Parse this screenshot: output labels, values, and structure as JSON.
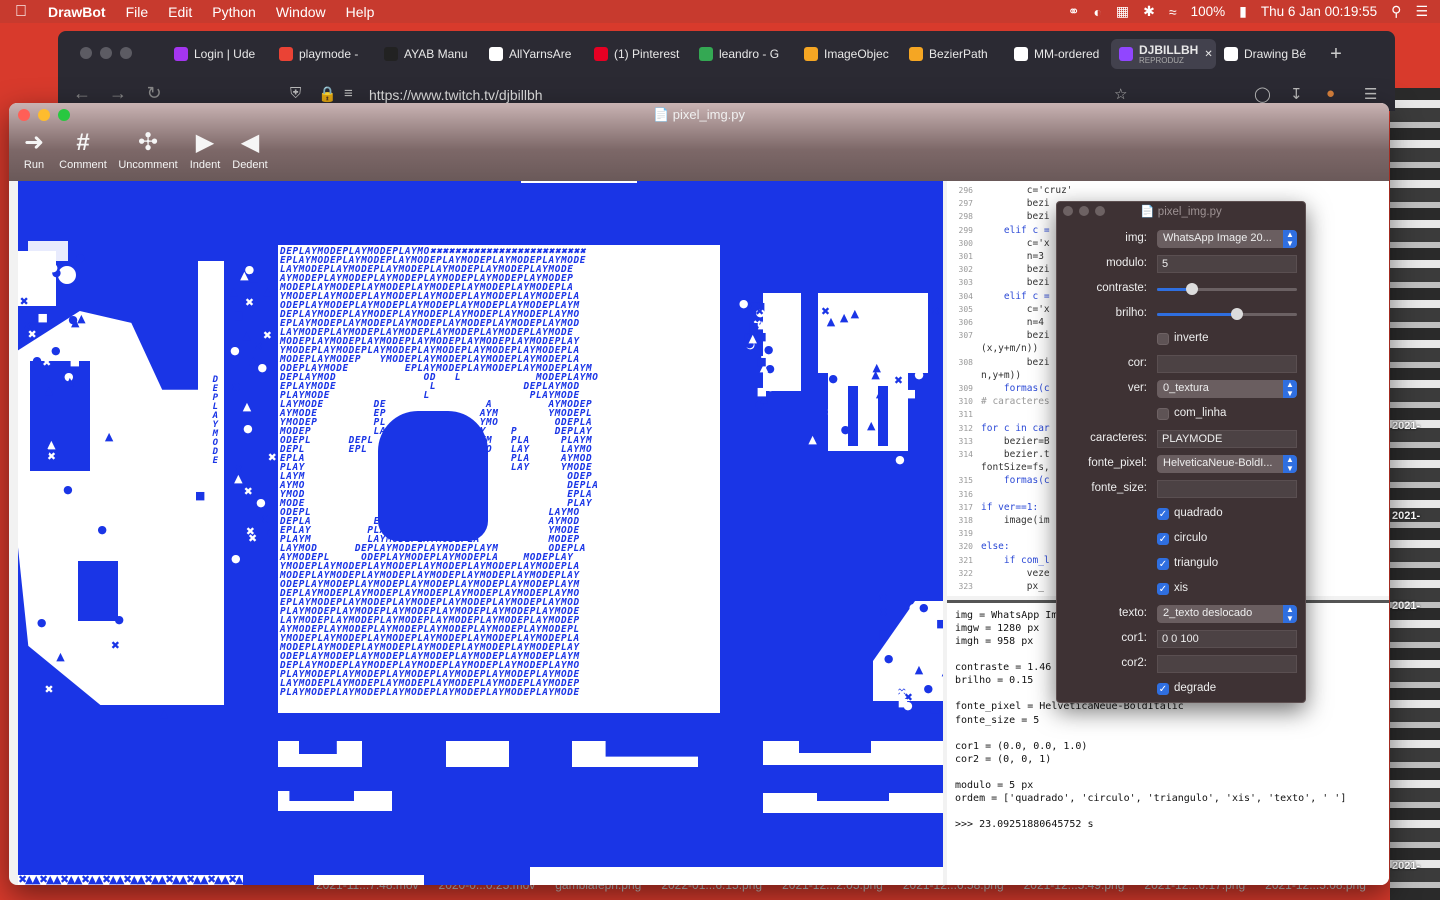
{
  "menubar": {
    "app": "DrawBot",
    "items": [
      "File",
      "Edit",
      "Python",
      "Window",
      "Help"
    ],
    "battery": "100%",
    "datetime": "Thu 6 Jan  00:19:55"
  },
  "browser": {
    "tabs": [
      {
        "label": "Login | Ude",
        "color": "#a435f0"
      },
      {
        "label": "playmode -",
        "color": "#ea4335"
      },
      {
        "label": "AYAB Manu",
        "color": "#222222"
      },
      {
        "label": "AllYarnsAre",
        "color": "#ffffff"
      },
      {
        "label": "(1) Pinterest",
        "color": "#e60023"
      },
      {
        "label": "leandro - G",
        "color": "#34a853"
      },
      {
        "label": "ImageObjec",
        "color": "#f5a623"
      },
      {
        "label": "BezierPath",
        "color": "#f5a623"
      },
      {
        "label": "MM-ordered",
        "color": "#ffffff"
      },
      {
        "label": "DJBILLBH",
        "sub": "REPRODUZ",
        "color": "#9146ff",
        "active": true
      },
      {
        "label": "Drawing Bé",
        "color": "#ffffff"
      }
    ],
    "url": "https://www.twitch.tv/djbillbh"
  },
  "drawbot": {
    "title": "pixel_img.py",
    "toolbar": [
      {
        "label": "Run",
        "icon": "run-icon"
      },
      {
        "label": "Comment",
        "icon": "comment-icon"
      },
      {
        "label": "Uncomment",
        "icon": "uncomment-icon"
      },
      {
        "label": "Indent",
        "icon": "indent-icon"
      },
      {
        "label": "Dedent",
        "icon": "dedent-icon"
      }
    ],
    "canvas": {
      "background": "#1a35e6",
      "text_rows": [
        "DEPLAYMODEPLAYMODEPLAYMO✖✖✖✖✖✖✖✖✖✖✖✖✖✖✖✖✖✖✖✖✖✖✖✖✖",
        "EPLAYMODEPLAYMODEPLAYMODEPLAYMODEPLAYMODEPLAYMODE",
        "LAYMODEPLAYMODEPLAYMODEPLAYMODEPLAYMODEPLAYMODE",
        "AYMODEPLAYMODEPLAYMODEPLAYMODEPLAYMODEPLAYMODEP",
        "MODEPLAYMODEPLAYMODEPLAYMODEPLAYMODEPLAYMODEPLA",
        "YMODEPLAYMODEPLAYMODEPLAYMODEPLAYMODEPLAYMODEPLA",
        "ODEPLAYMODEPLAYMODEPLAYMODEPLAYMODEPLAYMODEPLAYM",
        "DEPLAYMODEPLAYMODEPLAYMODEPLAYMODEPLAYMODEPLAYMO",
        "EPLAYMODEPLAYMODEPLAYMODEPLAYMODEPLAYMODEPLAYMOD",
        "LAYMODEPLAYMODEPLAYMODEPLAYMODEPLAYMODEPLAYMODE",
        "MODEPLAYMODEPLAYMODEPLAYMODEPLAYMODEPLAYMODEPLAY",
        "YMODEPLAYMODEPLAYMODEPLAYMODEPLAYMODEPLAYMODEPLA",
        "MODEPLAYMODEP   YMODEPLAYMODEPLAYMODEPLAYMODEPLA",
        "ODEPLAYMODE         EPLAYMODEPLAYMODEPLAYMODEPLAYM",
        "DEPLAYMOD              OD   L            MODEPLAYMO",
        "EPLAYMODE               L              DEPLAYMOD",
        "PLAYMODE               L                PLAYMODE",
        "LAYMODE        DE                A         AYMODEP",
        "AYMODE         EP               AYM        YMODEPL",
        "YMODEP         PL               YMO         ODEPLA",
        "MODEP          LA              AY    P      DEPLAY",
        "ODEPL      DEPL    MOD         AYM   PLA     PLAYM",
        "DEPL       EPL    ODE          YMO   LAY     LAYMO",
        "EPLA              MO                 PLA     AYMOD",
        "PLAY              OD                 LAY     YMODE",
        "LAYM                                          ODEP",
        "AYMO                                          DEPLA",
        "YMOD                  E                       EPLA",
        "MODE                EPLAYMOD                  PLAY",
        "ODEPL            EPLAYMODEPLAY             LAYMO",
        "DEPLA          EPLAYMODEPLAYMOD            AYMOD",
        "EPLAY         PLAYMODEPLAYMODEP            YMODE",
        "PLAYM         LAYMODEPLAYMODEPLA           MODEP",
        "LAYMOD      DEPLAYMODEPLAYMODEPLAYM        ODEPLA",
        "AYMODEPL     ODEPLAYMODEPLAYMODEPLA    MODEPLAY",
        "YMODEPLAYMODEPLAYMODEPLAYMODEPLAYMODEPLAYMODEPLA",
        "MODEPLAYMODEPLAYMODEPLAYMODEPLAYMODEPLAYMODEPLAY",
        "ODEPLAYMODEPLAYMODEPLAYMODEPLAYMODEPLAYMODEPLAYM",
        "DEPLAYMODEPLAYMODEPLAYMODEPLAYMODEPLAYMODEPLAYMO",
        "EPLAYMODEPLAYMODEPLAYMODEPLAYMODEPLAYMODEPLAYMOD",
        "PLAYMODEPLAYMODEPLAYMODEPLAYMODEPLAYMODEPLAYMODE",
        "LAYMODEPLAYMODEPLAYMODEPLAYMODEPLAYMODEPLAYMODEP",
        "AYMODEPLAYMODEPLAYMODEPLAYMODEPLAYMODEPLAYMODEPL",
        "YMODEPLAYMODEPLAYMODEPLAYMODEPLAYMODEPLAYMODEPLA",
        "MODEPLAYMODEPLAYMODEPLAYMODEPLAYMODEPLAYMODEPLAY",
        "ODEPLAYMODEPLAYMODEPLAYMODEPLAYMODEPLAYMODEPLAYM",
        "DEPLAYMODEPLAYMODEPLAYMODEPLAYMODEPLAYMODEPLAYMO",
        "PLAYMODEPLAYMODEPLAYMODEPLAYMODEPLAYMODEPLAYMODE",
        "LAYMODEPLAYMODEPLAYMODEPLAYMODEPLAYMODEPLAYMODEP",
        "PLAYMODEPLAYMODEPLAYMODEPLAYMODEPLAYMODEPLAYMODE"
      ],
      "side_letters": [
        "D",
        "E",
        "P",
        "L",
        "A",
        "Y",
        "M",
        "O",
        "D",
        "E"
      ]
    },
    "code": {
      "lines": [
        {
          "n": "296",
          "text": "        c='cruz'"
        },
        {
          "n": "297",
          "text": "        bezi"
        },
        {
          "n": "298",
          "text": "        bezi"
        },
        {
          "n": "299",
          "text": "    elif c ="
        },
        {
          "n": "300",
          "text": "        c='x"
        },
        {
          "n": "301",
          "text": "        n=3"
        },
        {
          "n": "302",
          "text": "        bezi                          +m/n,y+m))"
        },
        {
          "n": "303",
          "text": "        bezi                          ,(x,y+m),)"
        },
        {
          "n": "304",
          "text": "    elif c ="
        },
        {
          "n": "305",
          "text": "        c='x"
        },
        {
          "n": "306",
          "text": "        n=4"
        },
        {
          "n": "307",
          "text": "        bezi                          /n,y+m),"
        },
        {
          "n": "",
          "text": "(x,y+m/n))"
        },
        {
          "n": "308",
          "text": "        bezi                          +m/n),(x+m/"
        },
        {
          "n": "",
          "text": "n,y+m))"
        },
        {
          "n": "309",
          "text": "    formas(c"
        },
        {
          "n": "310",
          "text": "# caracteres"
        },
        {
          "n": "311",
          "text": ""
        },
        {
          "n": "312",
          "text": "for c in car"
        },
        {
          "n": "313",
          "text": "    bezier=B"
        },
        {
          "n": "314",
          "text": "    bezier.t                          onte_px,"
        },
        {
          "n": "",
          "text": "fontSize=fs,"
        },
        {
          "n": "315",
          "text": "    formas(c"
        },
        {
          "n": "316",
          "text": ""
        },
        {
          "n": "317",
          "text": "if ver==1:"
        },
        {
          "n": "318",
          "text": "    image(im"
        },
        {
          "n": "319",
          "text": ""
        },
        {
          "n": "320",
          "text": "else:"
        },
        {
          "n": "321",
          "text": "    if com_l"
        },
        {
          "n": "322",
          "text": "        veze"
        },
        {
          "n": "323",
          "text": "        px_"
        }
      ]
    },
    "output": [
      "img = WhatsApp Im",
      "imgw = 1280 px",
      "imgh = 958 px",
      "",
      "contraste = 1.46",
      "brilho = 0.15",
      "",
      "fonte_pixel = HelveticaNeue-BoldItalic",
      "fonte_size = 5",
      "",
      "cor1 = (0.0, 0.0, 1.0)",
      "cor2 = (0, 0, 1)",
      "",
      "modulo = 5 px",
      "ordem = ['quadrado', 'circulo', 'triangulo', 'xis', 'texto', ' ']",
      "",
      ">>> 23.09251880645752 s"
    ]
  },
  "variables": {
    "title": "pixel_img.py",
    "img": {
      "label": "img:",
      "value": "WhatsApp Image 20..."
    },
    "modulo": {
      "label": "modulo:",
      "value": "5"
    },
    "contraste": {
      "label": "contraste:",
      "level": 0.25
    },
    "brilho": {
      "label": "brilho:",
      "level": 0.57
    },
    "inverte": {
      "label": "inverte",
      "checked": false
    },
    "cor": {
      "label": "cor:",
      "value": ""
    },
    "ver": {
      "label": "ver:",
      "value": "0_textura"
    },
    "com_linha": {
      "label": "com_linha",
      "checked": false
    },
    "caracteres": {
      "label": "caracteres:",
      "value": "PLAYMODE"
    },
    "fonte_pixel": {
      "label": "fonte_pixel:",
      "value": "HelveticaNeue-BoldI..."
    },
    "fonte_size": {
      "label": "fonte_size:",
      "value": ""
    },
    "quadrado": {
      "label": "quadrado",
      "checked": true
    },
    "circulo": {
      "label": "circulo",
      "checked": true
    },
    "triangulo": {
      "label": "triangulo",
      "checked": true
    },
    "xis": {
      "label": "xis",
      "checked": true
    },
    "texto": {
      "label": "texto:",
      "value": "2_texto deslocado"
    },
    "cor1": {
      "label": "cor1:",
      "value": "0 0 100"
    },
    "cor2": {
      "label": "cor2:",
      "value": ""
    },
    "degrade": {
      "label": "degrade",
      "checked": true
    }
  },
  "dock_files": [
    "2021-11...7.48.mov",
    "2020-0...0.25.mov",
    "gambiaIeph.png",
    "2022-01...6.15.png",
    "2021-12...2.05.png",
    "2021-12...6.58.png",
    "2021-12...5.49.png",
    "2021-12...6.17.png",
    "2021-12...5.08.png"
  ],
  "desktop_label": "2021-"
}
